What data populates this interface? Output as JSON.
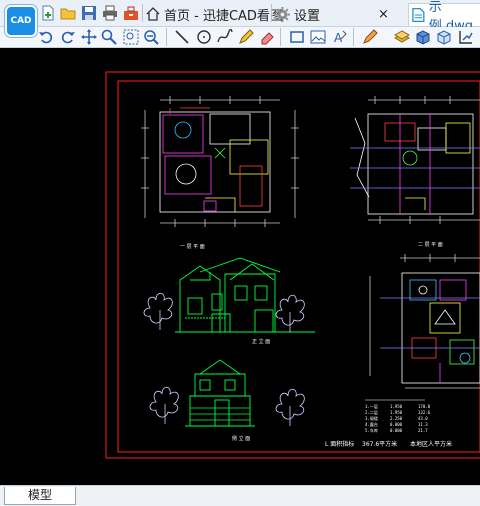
{
  "app": {
    "logo_text": "CAD"
  },
  "tabs": [
    {
      "label": "首页 - 迅捷CAD看图",
      "icon": "home-icon"
    },
    {
      "label": "设置",
      "icon": "gear-icon"
    },
    {
      "label": "示例.dwg",
      "icon": "document-icon",
      "active": true
    }
  ],
  "drawing": {
    "labels": {
      "plan1": "一 层 平 面",
      "plan2": "二 层 平 面",
      "front": "正 立 面",
      "side": "侧 立 面"
    },
    "table": {
      "title": "L 面积指标",
      "area": "367.6平方米",
      "note": "本地区人平方米"
    }
  },
  "status": {
    "model_tab": "模型"
  },
  "colors": {
    "accent": "#1a8ee6",
    "canvas_bg": "#000000",
    "frame": "#ff2020",
    "elevation": "#00ff40",
    "tree": "#d0d0ff"
  }
}
